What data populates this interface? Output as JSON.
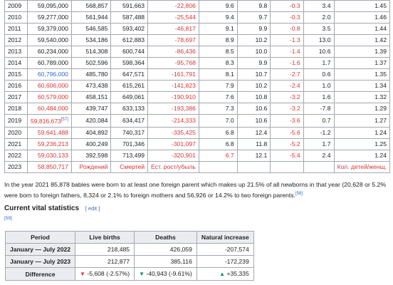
{
  "demographics": {
    "rows": [
      {
        "year": "2009",
        "population": "59,095,000",
        "live_births": "568,857",
        "deaths": "591,663",
        "natural_change": "-22,806",
        "crude_birth_rate": "9.6",
        "crude_death_rate": "9.8",
        "natural_change_rate": "-0.3",
        "migration_rate": "3.4",
        "fertility": "1.45",
        "pop_style": "normal",
        "ref": ""
      },
      {
        "year": "2010",
        "population": "59,277,000",
        "live_births": "561,944",
        "deaths": "587,488",
        "natural_change": "-25,544",
        "crude_birth_rate": "9.4",
        "crude_death_rate": "9.7",
        "natural_change_rate": "-0.3",
        "migration_rate": "2.0",
        "fertility": "1.46",
        "pop_style": "normal",
        "ref": ""
      },
      {
        "year": "2011",
        "population": "59,379,000",
        "live_births": "546,585",
        "deaths": "593,402",
        "natural_change": "-46,817",
        "crude_birth_rate": "9.1",
        "crude_death_rate": "9.9",
        "natural_change_rate": "-0.8",
        "migration_rate": "3.5",
        "fertility": "1.44",
        "pop_style": "normal",
        "ref": ""
      },
      {
        "year": "2012",
        "population": "59,540,000",
        "live_births": "534,186",
        "deaths": "612,883",
        "natural_change": "-78,697",
        "crude_birth_rate": "8.9",
        "crude_death_rate": "10.2",
        "natural_change_rate": "-1.3",
        "migration_rate": "13.0",
        "fertility": "1.42",
        "pop_style": "normal",
        "ref": ""
      },
      {
        "year": "2013",
        "population": "60,234,000",
        "live_births": "514,308",
        "deaths": "600,744",
        "natural_change": "-86,436",
        "crude_birth_rate": "8.5",
        "crude_death_rate": "10.0",
        "natural_change_rate": "-1.4",
        "migration_rate": "10.6",
        "fertility": "1.39",
        "pop_style": "normal",
        "ref": ""
      },
      {
        "year": "2014",
        "population": "60,789,000",
        "live_births": "502,596",
        "deaths": "598,364",
        "natural_change": "-95,768",
        "crude_birth_rate": "8.3",
        "crude_death_rate": "9.9",
        "natural_change_rate": "-1.6",
        "migration_rate": "1.7",
        "fertility": "1.37",
        "pop_style": "normal",
        "ref": ""
      },
      {
        "year": "2015",
        "population": "60,796,000",
        "live_births": "485,780",
        "deaths": "647,571",
        "natural_change": "-161,791",
        "crude_birth_rate": "8.1",
        "crude_death_rate": "10.7",
        "natural_change_rate": "-2.7",
        "migration_rate": "0.6",
        "fertility": "1.35",
        "pop_style": "blue",
        "ref": ""
      },
      {
        "year": "2016",
        "population": "60,606,000",
        "live_births": "473,438",
        "deaths": "615,261",
        "natural_change": "-141,823",
        "crude_birth_rate": "7.9",
        "crude_death_rate": "10.2",
        "natural_change_rate": "-2.4",
        "migration_rate": "1.0",
        "fertility": "1.34",
        "pop_style": "red",
        "ref": ""
      },
      {
        "year": "2017",
        "population": "60,579,000",
        "live_births": "458,151",
        "deaths": "649,061",
        "natural_change": "-190,910",
        "crude_birth_rate": "7.6",
        "crude_death_rate": "10.8",
        "natural_change_rate": "-3.2",
        "migration_rate": "1.6",
        "fertility": "1.32",
        "pop_style": "red",
        "ref": ""
      },
      {
        "year": "2018",
        "population": "60,484,000",
        "live_births": "439,747",
        "deaths": "633,133",
        "natural_change": "-193,386",
        "crude_birth_rate": "7.3",
        "crude_death_rate": "10.6",
        "natural_change_rate": "-3.2",
        "migration_rate": "-7.8",
        "fertility": "1.29",
        "pop_style": "red",
        "ref": ""
      },
      {
        "year": "2019",
        "population": "59,816,673",
        "live_births": "420,084",
        "deaths": "634,417",
        "natural_change": "-214,333",
        "crude_birth_rate": "7.0",
        "crude_death_rate": "10.6",
        "natural_change_rate": "-3.6",
        "migration_rate": "0.7",
        "fertility": "1.27",
        "pop_style": "red",
        "ref": "[57]"
      },
      {
        "year": "2020",
        "population": "59,641,488",
        "live_births": "404,892",
        "deaths": "740,317",
        "natural_change": "-335,425",
        "crude_birth_rate": "6.8",
        "crude_death_rate": "12.4",
        "natural_change_rate": "-5.6",
        "migration_rate": "-1.2",
        "fertility": "1.24",
        "pop_style": "red",
        "ref": ""
      },
      {
        "year": "2021",
        "population": "59,236,213",
        "live_births": "400,249",
        "deaths": "701,346",
        "natural_change": "-301,097",
        "crude_birth_rate": "6.8",
        "crude_death_rate": "11.8",
        "natural_change_rate": "-5.2",
        "migration_rate": "1.7",
        "fertility": "1.25",
        "pop_style": "red",
        "ref": ""
      },
      {
        "year": "2022",
        "population": "59,030,133",
        "live_births": "392,598",
        "deaths": "713,499",
        "natural_change": "-320,901",
        "crude_birth_rate": "6.7",
        "crude_death_rate": "12.1",
        "natural_change_rate": "-5.4",
        "migration_rate": "2.4",
        "fertility": "1.24",
        "pop_style": "red",
        "ref": ""
      },
      {
        "year": "2023",
        "population": "58,850,717",
        "live_births": "Рождений",
        "deaths": "Смертей",
        "natural_change": "Ест. рост/убыль",
        "crude_birth_rate": "",
        "crude_death_rate": "",
        "natural_change_rate": "",
        "migration_rate": "",
        "fertility": "Кол. детей/женщ.",
        "pop_style": "red",
        "ref": ""
      }
    ]
  },
  "paragraph": {
    "text": "In the year 2021 85,878 babies were born to at least one foreign parent which makes up 21.5% of all newborns in that year (20,628 or 5.2% were born to foreign fathers, 8,324 or 2.1% to foreign mothers and 56,926 or 14.2% to two foreign parents.",
    "ref": "[58]"
  },
  "section": {
    "title": "Current vital statistics",
    "edit_label": "edit",
    "ref": "[59]"
  },
  "vital": {
    "headers": [
      "Period",
      "Live births",
      "Deaths",
      "Natural increase"
    ],
    "rows": [
      {
        "period": "January — July 2022",
        "births": "218,485",
        "deaths": "426,059",
        "increase": "-207,574"
      },
      {
        "period": "January — July 2023",
        "births": "212,877",
        "deaths": "385,116",
        "increase": "-172,239"
      }
    ],
    "difference": {
      "label": "Difference",
      "births": "-5,608 (-2.57%)",
      "deaths": "-40,943 (-9.61%)",
      "increase": "+35,335"
    }
  },
  "colors": {
    "red": "#dd3333",
    "blue": "#3366cc",
    "green": "#14866d",
    "header_bg": "#eaecf0",
    "border": "#a2a9b1"
  }
}
